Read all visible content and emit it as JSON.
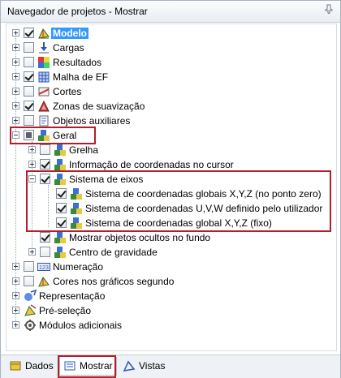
{
  "panel": {
    "title": "Navegador de projetos - Mostrar",
    "pin_icon": "pin-icon"
  },
  "tree": {
    "modelo": {
      "label": "Modelo",
      "checked": true
    },
    "cargas": {
      "label": "Cargas"
    },
    "resultados": {
      "label": "Resultados"
    },
    "malha": {
      "label": "Malha de EF"
    },
    "cortes": {
      "label": "Cortes"
    },
    "zonas": {
      "label": "Zonas de suavização"
    },
    "objetos_aux": {
      "label": "Objetos auxiliares"
    },
    "geral": {
      "label": "Geral",
      "children": {
        "grelha": {
          "label": "Grelha"
        },
        "info_coord": {
          "label": "Informação de coordenadas no cursor"
        },
        "sistema_eixos": {
          "label": "Sistema de eixos",
          "children": {
            "globais": {
              "label": "Sistema de coordenadas globais X,Y,Z (no ponto zero)"
            },
            "uvw": {
              "label": "Sistema de coordenadas U,V,W definido pelo utilizador"
            },
            "global_fixo": {
              "label": "Sistema de coordenadas global X,Y,Z (fixo)"
            }
          }
        },
        "ocultos": {
          "label": "Mostrar objetos ocultos no fundo"
        },
        "centro_grav": {
          "label": "Centro de gravidade"
        }
      }
    },
    "numeracao": {
      "label": "Numeração"
    },
    "cores": {
      "label": "Cores nos gráficos segundo"
    },
    "representacao": {
      "label": "Representação"
    },
    "pre_selecao": {
      "label": "Pré-seleção"
    },
    "modulos": {
      "label": "Módulos adicionais"
    }
  },
  "tabs": {
    "dados": "Dados",
    "mostrar": "Mostrar",
    "vistas": "Vistas"
  },
  "colors": {
    "selection": "#3399ff",
    "highlight_box": "#b21e2b"
  }
}
